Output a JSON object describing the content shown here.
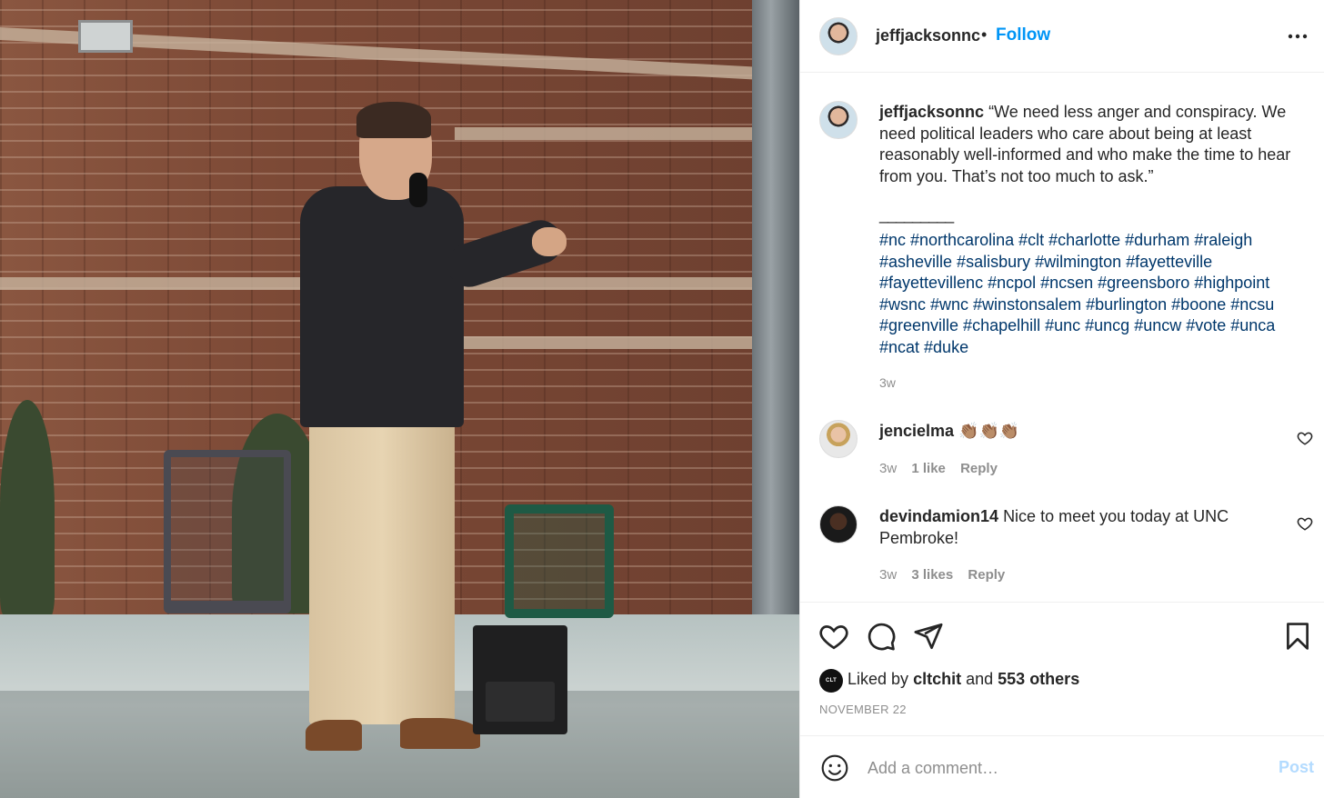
{
  "post": {
    "username": "jeffjacksonnc",
    "dot": "•",
    "follow_label": "Follow",
    "caption": "“We need less anger and conspiracy. We need political leaders who care about being at least reasonably well-informed and who make the time to hear from you. That’s not too much to ask.”",
    "divider": "_________",
    "hashtags": "#nc #northcarolina #clt #charlotte #durham #raleigh #asheville #salisbury #wilmington #fayetteville #fayettevillenc #ncpol #ncsen #greensboro #highpoint #wsnc #wnc #winstonsalem #burlington #boone #ncsu #greenville #chapelhill #unc #uncg #uncw #vote #unca #ncat #duke",
    "time": "3w"
  },
  "comments": [
    {
      "username": "jencielma",
      "text": "👏🏽👏🏽👏🏽",
      "time": "3w",
      "likes": "1 like",
      "reply": "Reply"
    },
    {
      "username": "devindamion14",
      "text": "Nice to meet you today at UNC Pembroke!",
      "time": "3w",
      "likes": "3 likes",
      "reply": "Reply"
    }
  ],
  "engagement": {
    "liked_prefix": "Liked by",
    "liked_user": "cltchit",
    "liked_and": "and",
    "liked_others": "553 others",
    "date": "NOVEMBER 22"
  },
  "comment_box": {
    "placeholder": "Add a comment…",
    "post_label": "Post"
  },
  "colors": {
    "link_blue": "#0095f6",
    "hashtag_blue": "#00376b",
    "muted": "#8e8e8e",
    "post_disabled": "#b3dbff"
  },
  "icons": [
    "more-options-icon",
    "heart-icon",
    "comment-icon",
    "share-icon",
    "bookmark-icon",
    "emoji-icon"
  ]
}
